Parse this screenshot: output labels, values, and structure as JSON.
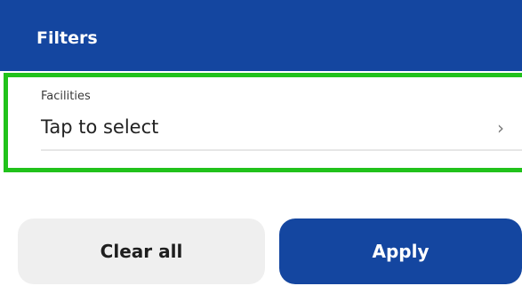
{
  "header": {
    "title": "Filters"
  },
  "facilities": {
    "label": "Facilities",
    "value": "Tap to select",
    "chevron_icon": "chevron-right-icon"
  },
  "actions": {
    "clear_label": "Clear all",
    "apply_label": "Apply"
  },
  "colors": {
    "primary": "#1446a0",
    "highlight": "#21c21b",
    "secondary_button": "#efefef"
  }
}
